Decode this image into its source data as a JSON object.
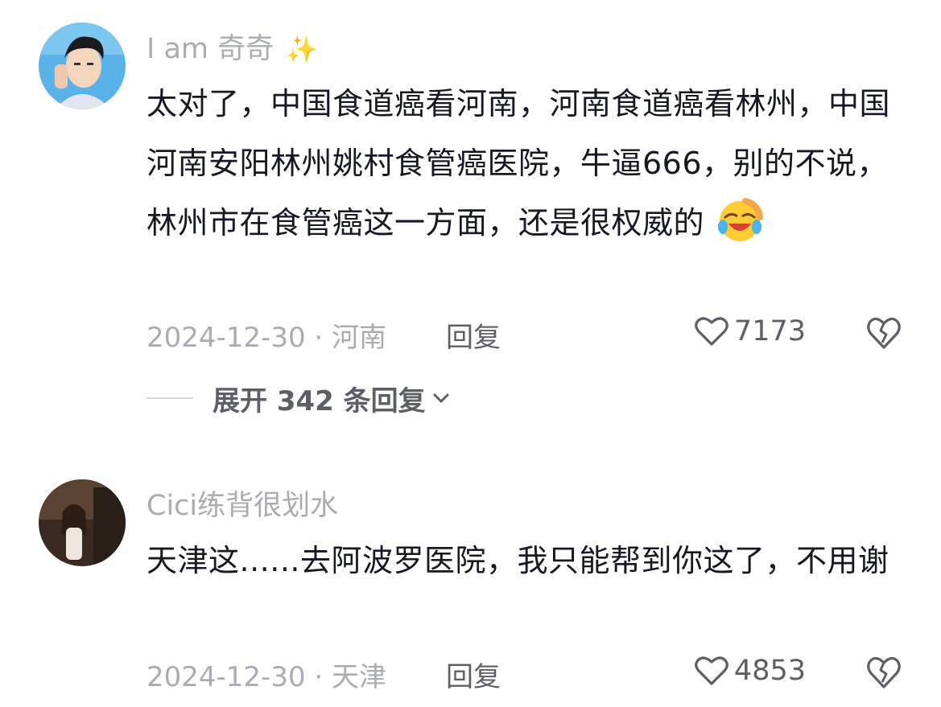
{
  "comments": [
    {
      "username": "I  am  奇奇",
      "username_emoji": "✨",
      "text": "太对了，中国食道癌看河南，河南食道癌看林州，中国河南安阳林州姚村食管癌医院，牛逼666，别的不说，林州市在食管癌这一方面，还是很权威的",
      "trailing_emoji": "laughing-crying-face-icon",
      "date_location": "2024-12-30 · 河南",
      "reply_label": "回复",
      "likes": "7173",
      "expand_label": "展开 342 条回复"
    },
    {
      "username": "Cici练背很划水",
      "text": "天津这......去阿波罗医院，我只能帮到你这了，不用谢",
      "date_location": "2024-12-30 · 天津",
      "reply_label": "回复",
      "likes": "4853"
    }
  ],
  "colors": {
    "text_primary": "#161823",
    "text_secondary": "#a9acb3",
    "text_action": "#5d5f66"
  }
}
